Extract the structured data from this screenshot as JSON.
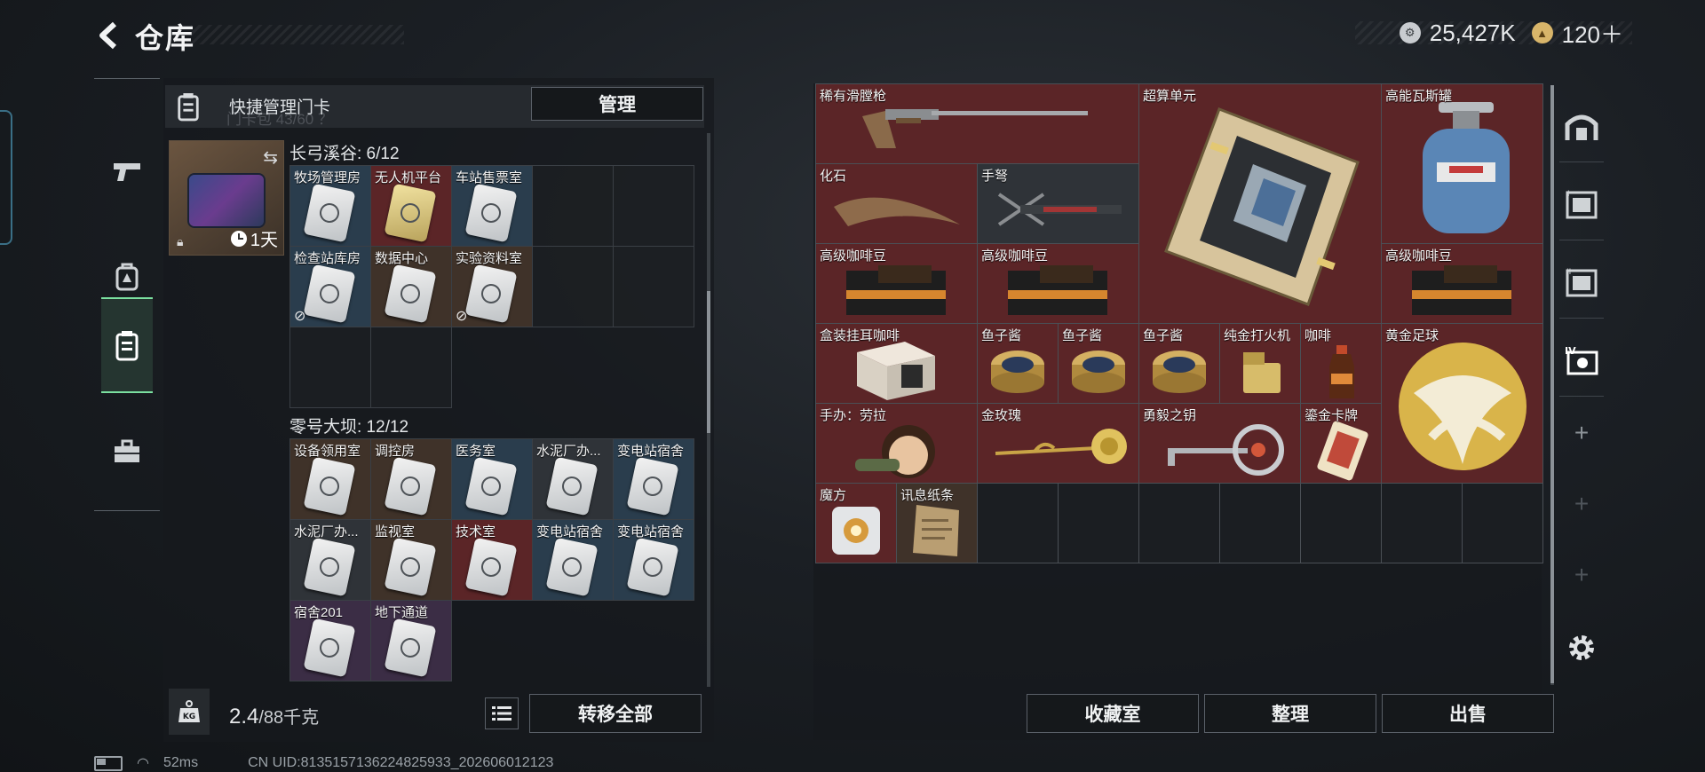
{
  "header": {
    "title": "仓库",
    "currency_1": "25,427K",
    "currency_2": "120＋",
    "currency_1_icon": "coin-icon",
    "currency_2_icon": "triangle-coin-icon"
  },
  "left_nav": {
    "items": [
      {
        "name": "weapon",
        "icon": "pistol-icon"
      },
      {
        "name": "gear",
        "icon": "backpack-icon"
      },
      {
        "name": "card",
        "icon": "keycard-case-icon",
        "active": true
      },
      {
        "name": "toolbox",
        "icon": "toolbox-icon"
      }
    ]
  },
  "quick_card": {
    "label": "快捷管理门卡",
    "ghost_text": "门卡包 43/60 ？",
    "manage_label": "管理"
  },
  "keycase": {
    "time": "1天"
  },
  "sections": [
    {
      "title": "长弓溪谷: 6/12",
      "cells": [
        {
          "name": "牧场管理房",
          "color": "c-blue",
          "card": true
        },
        {
          "name": "无人机平台",
          "color": "c-red",
          "card": "gold"
        },
        {
          "name": "车站售票室",
          "color": "c-blue",
          "card": true
        },
        {
          "name": "",
          "color": "c-empty"
        },
        {
          "name": "",
          "color": "c-empty"
        },
        {
          "name": "检查站库房",
          "color": "c-blue",
          "card": true,
          "nocard": true
        },
        {
          "name": "数据中心",
          "color": "c-brown",
          "card": true
        },
        {
          "name": "实验资料室",
          "color": "c-brown",
          "card": true,
          "nocard": true
        },
        {
          "name": "",
          "color": "c-empty"
        },
        {
          "name": "",
          "color": "c-empty"
        },
        {
          "name": "",
          "color": "c-empty"
        },
        {
          "name": "",
          "color": "c-empty"
        }
      ]
    },
    {
      "title": "零号大坝: 12/12",
      "cells": [
        {
          "name": "设备领用室",
          "color": "c-brown",
          "card": true
        },
        {
          "name": "调控房",
          "color": "c-brown",
          "card": true
        },
        {
          "name": "医务室",
          "color": "c-blue",
          "card": true
        },
        {
          "name": "水泥厂办...",
          "color": "c-gray",
          "card": true
        },
        {
          "name": "变电站宿舍",
          "color": "c-blue",
          "card": true
        },
        {
          "name": "水泥厂办...",
          "color": "c-gray",
          "card": true
        },
        {
          "name": "监视室",
          "color": "c-brown",
          "card": true
        },
        {
          "name": "技术室",
          "color": "c-red",
          "card": true
        },
        {
          "name": "变电站宿舍",
          "color": "c-blue",
          "card": true
        },
        {
          "name": "变电站宿舍",
          "color": "c-blue",
          "card": true
        },
        {
          "name": "宿舍201",
          "color": "c-purple",
          "card": true
        },
        {
          "name": "地下通道",
          "color": "c-purple",
          "card": true
        }
      ]
    }
  ],
  "footer_left": {
    "weight_current": "2.4",
    "weight_max": "/88千克",
    "transfer_label": "转移全部",
    "weight_icon": "kg-weight-icon"
  },
  "items": [
    {
      "name": "稀有滑膛枪",
      "color": "c-red"
    },
    {
      "name": "超算单元",
      "color": "c-red"
    },
    {
      "name": "高能瓦斯罐",
      "color": "c-red"
    },
    {
      "name": "化石",
      "color": "c-red"
    },
    {
      "name": "手弩",
      "color": "c-red"
    },
    {
      "name": "高级咖啡豆",
      "color": "c-red"
    },
    {
      "name": "高级咖啡豆",
      "color": "c-red"
    },
    {
      "name": "高级咖啡豆",
      "color": "c-red"
    },
    {
      "name": "盒装挂耳咖啡",
      "color": "c-red"
    },
    {
      "name": "鱼子酱",
      "color": "c-red"
    },
    {
      "name": "鱼子酱",
      "color": "c-red"
    },
    {
      "name": "鱼子酱",
      "color": "c-red"
    },
    {
      "name": "纯金打火机",
      "color": "c-red"
    },
    {
      "name": "咖啡",
      "color": "c-red"
    },
    {
      "name": "黄金足球",
      "color": "c-red"
    },
    {
      "name": "手办：劳拉",
      "color": "c-red"
    },
    {
      "name": "金玫瑰",
      "color": "c-red"
    },
    {
      "name": "勇毅之钥",
      "color": "c-red"
    },
    {
      "name": "鎏金卡牌",
      "color": "c-red"
    },
    {
      "name": "魔方",
      "color": "c-red"
    },
    {
      "name": "讯息纸条",
      "color": "c-brown"
    }
  ],
  "right_buttons": {
    "collection": "收藏室",
    "organize": "整理",
    "sell": "出售"
  },
  "right_tabs": [
    {
      "icon": "safehouse-icon"
    },
    {
      "icon": "storage-box-1-icon"
    },
    {
      "icon": "storage-box-2-icon"
    },
    {
      "icon": "storage-box-4-icon",
      "active": true
    },
    {
      "icon": "plus-icon"
    },
    {
      "icon": "plus-icon"
    },
    {
      "icon": "plus-icon"
    },
    {
      "icon": "gear-icon"
    }
  ],
  "status": {
    "ping": "52ms",
    "uid": "CN UID:8135157136224825933_202606012123"
  },
  "colors": {
    "accent_green": "#7be0a0",
    "rarity_red": "#5b2527",
    "rarity_blue": "#2a3d4d",
    "rarity_brown": "#3f3229"
  }
}
